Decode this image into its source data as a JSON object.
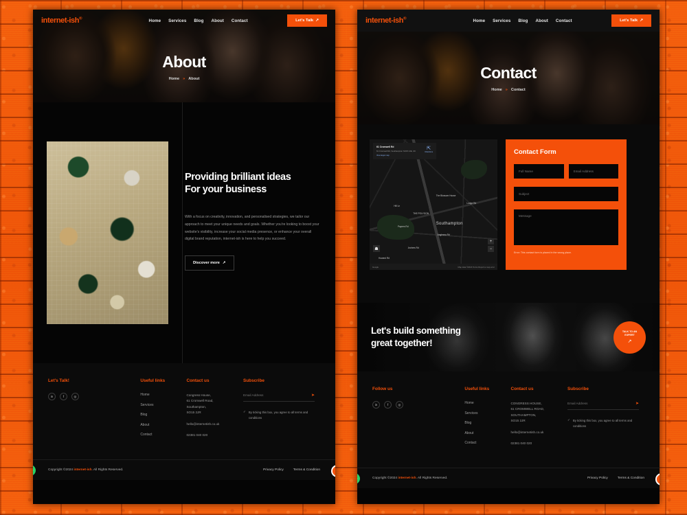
{
  "theme": {
    "accent": "#f4500a",
    "page_bg": "#050505",
    "wall_bg": "#f05a0a",
    "whatsapp_green": "#25d366"
  },
  "brand": {
    "name": "internet-ish",
    "mark": "®"
  },
  "nav": {
    "links": [
      "Home",
      "Services",
      "Blog",
      "About",
      "Contact"
    ],
    "cta": "Let's Talk",
    "cta_icon": "↗"
  },
  "about_page": {
    "hero": {
      "title": "About",
      "breadcrumb": {
        "home": "Home",
        "separator": "»",
        "current": "About"
      }
    },
    "section": {
      "heading_line1": "Providing brilliant ideas",
      "heading_line2": "For your business",
      "paragraph": "With a focus on creativity, innovation, and personalised strategies, we tailor our approach to meet your unique needs and goals. Whether you're looking to boost your website's visibility, increase your social media presence, or enhance your overall digital brand reputation, internet-ish is here to help you succeed.",
      "button": "Discover more",
      "button_icon": "↗",
      "image_alt": "team-desk-flatlay-photo"
    }
  },
  "contact_page": {
    "hero": {
      "title": "Contact",
      "breadcrumb": {
        "home": "Home",
        "separator": "»",
        "current": "Contact"
      }
    },
    "map": {
      "card_title": "61 Cromwell Rd",
      "card_address": "61 Cromwell Rd, Southampton SO15 2JE, UK",
      "card_link": "View larger map",
      "directions_label": "Directions",
      "directions_icon": "⇱",
      "city_label": "Southampton",
      "zoom_in": "+",
      "zoom_out": "−",
      "pegman_icon": "☗",
      "attribution_left": "Google",
      "attribution_right": "Map data ©2024  Terms  Report a map error",
      "labels": [
        "The Blossom House",
        "Hill Ln",
        "Lodge Rd",
        "Anglesea Rd",
        "Archers Rd",
        "Howard Rd",
        "Paynes Rd",
        "THE POLYGON"
      ]
    },
    "form": {
      "title": "Contact Form",
      "fields": {
        "full_name": "Full Name",
        "email": "Email Address",
        "subject": "Subject",
        "message": "Message"
      },
      "error": "Error: This contact form is placed in the wrong place."
    },
    "cta": {
      "line1": "Let's build something",
      "line2": "great together!",
      "button_line1": "TALK TO AN",
      "button_line2": "EXPERT",
      "button_icon": "↗"
    }
  },
  "footer": {
    "talk": {
      "heading_left": "Let's Talk!",
      "heading_right": "Follow us",
      "socials": [
        {
          "name": "linkedin-icon",
          "glyph": "in"
        },
        {
          "name": "facebook-icon",
          "glyph": "f"
        },
        {
          "name": "instagram-icon",
          "glyph": "◎"
        }
      ]
    },
    "useful_links": {
      "heading": "Useful links",
      "items": [
        "Home",
        "Services",
        "Blog",
        "About",
        "Contact"
      ]
    },
    "contact_us": {
      "heading": "Contact us",
      "address_left": "Congress House,\n61 Cromwell Road,\nSouthampton,\nSO15 2JR",
      "address_right": "CONGRESS HOUSE,\n61 CROMWELL ROAD,\nSOUTHAMPTON,\nSO15 2JR",
      "email": "hello@internetish.co.uk",
      "phone": "02381 040 020"
    },
    "subscribe": {
      "heading": "Subscribe",
      "placeholder": "Email Address",
      "send_icon": "➤",
      "checkbox_glyph": "✓",
      "consent": "By ticking this box, you agree to all terms and conditions"
    }
  },
  "bottom_bar": {
    "copyright_pre": "Copyright ©2024 ",
    "copyright_brand": "internet-ish",
    "copyright_post": ". All Rights Reserved.",
    "links": [
      "Privacy Policy",
      "Terms & Condition"
    ],
    "whatsapp_icon": "✆",
    "scroll_top_icon": "↑"
  }
}
